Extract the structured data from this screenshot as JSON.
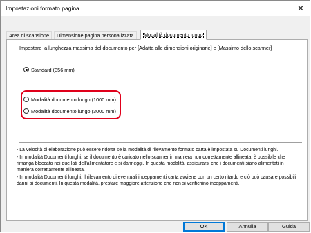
{
  "window": {
    "title": "Impostazioni formato pagina",
    "close_symbol": "✕"
  },
  "tabs": [
    {
      "label": "Area di scansione",
      "active": false
    },
    {
      "label": "Dimensione pagina personalizzata",
      "active": false
    },
    {
      "label": "Modalità documento lungo",
      "active": true
    }
  ],
  "panel": {
    "description": "Impostare la lunghezza massima del documento per [Adatta alle dimensioni originarie] e [Massimo dello scanner]",
    "options": [
      {
        "label": "Standard (356 mm)",
        "selected": true
      },
      {
        "label": "Modalità documento lungo (1000 mm)",
        "selected": false
      },
      {
        "label": "Modalità documento lungo (3000 mm)",
        "selected": false
      }
    ],
    "notes": [
      "- La velocità di elaborazione può essere ridotta se la modalità di rilevamento formato carta è impostata su Documenti lunghi.",
      "- In modalità Documenti lunghi, se il documento è caricato nello scanner in maniera non correttamente allineata, è possibile che rimanga bloccato nei due lati dell'alimentatore e si danneggi. In questa modalità, assicurarsi che i documenti siano alimentati in maniera correttamente allineata.",
      "- In modalità Documenti lunghi, il rilevamento di eventuali inceppamenti carta avviene con un certo ritardo e ciò può causare possibili danni ai documenti. In questa modalità, prestare maggiore attenzione che non si verifichino inceppamenti."
    ]
  },
  "buttons": {
    "ok": "OK",
    "cancel": "Annulla",
    "help": "Guida"
  },
  "colors": {
    "highlight": "#e0001b",
    "default_button_border": "#0078d7"
  }
}
